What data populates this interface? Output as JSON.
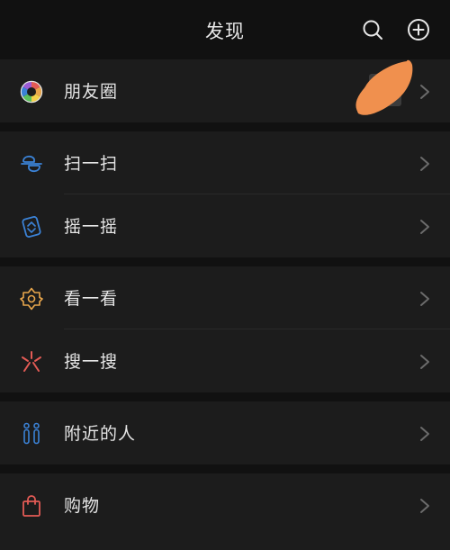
{
  "header": {
    "title": "发现",
    "icons": [
      "search-icon",
      "plus-circle-icon"
    ]
  },
  "menu": {
    "moments": "朋友圈",
    "scan": "扫一扫",
    "shake": "摇一摇",
    "top_stories": "看一看",
    "search": "搜一搜",
    "people_nearby": "附近的人",
    "shopping": "购物"
  },
  "colors": {
    "background": "#111111",
    "row_background": "#1c1c1c",
    "text": "#e6e6e6",
    "chevron": "#6b6b6b",
    "scan_icon": "#3b82d6",
    "shake_icon": "#3b82d6",
    "top_stories_icon": "#e8a64c",
    "search_icon": "#e35b55",
    "nearby_icon": "#3b82d6",
    "shopping_icon": "#e35b55",
    "redaction": "#f0904e"
  }
}
